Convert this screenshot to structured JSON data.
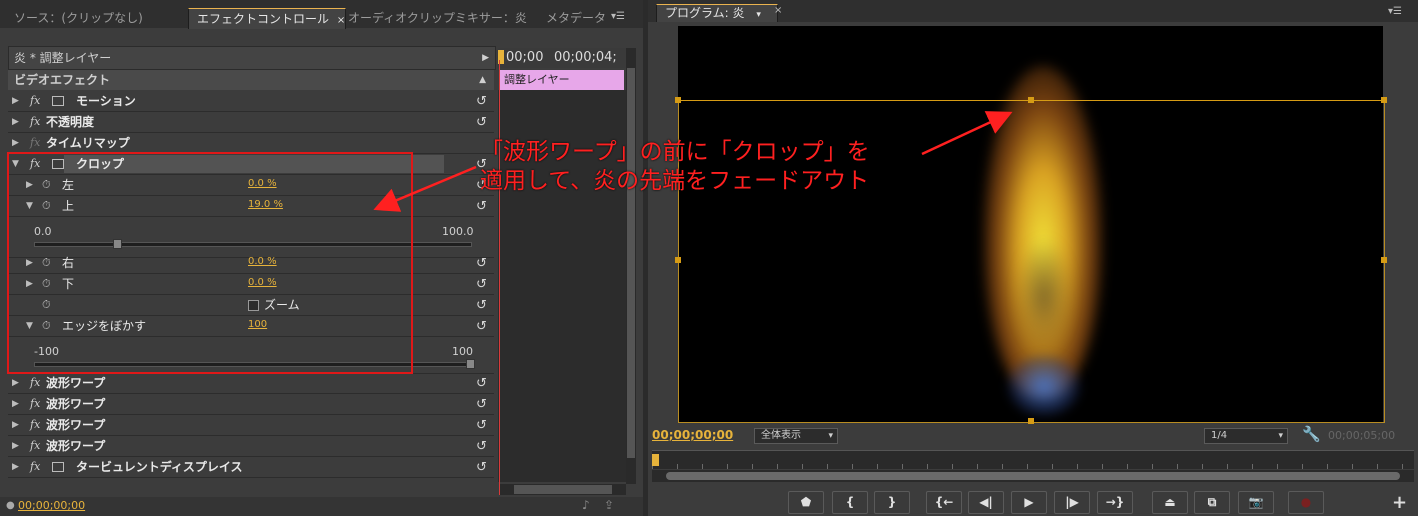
{
  "left_panel": {
    "tabs": [
      "ソース：(クリップなし)",
      "エフェクトコントロール",
      "オーディオクリップミキサー：炎",
      "メタデータ"
    ],
    "close_mark": "×",
    "clip_header": "炎 * 調整レイヤー",
    "section_title": "ビデオエフェクト",
    "timeline": {
      "t1": "00;00",
      "t2": "00;00;04;",
      "clip_label": "調整レイヤー"
    },
    "effects": [
      {
        "label": "モーション",
        "has_icon": true
      },
      {
        "label": "不透明度",
        "has_icon": false
      },
      {
        "label": "タイムリマップ",
        "has_icon": false
      },
      {
        "label": "クロップ",
        "has_icon": true
      }
    ],
    "crop_params": {
      "left": {
        "label": "左",
        "value": "0.0 %"
      },
      "top": {
        "label": "上",
        "value": "19.0 %"
      },
      "top_slider": {
        "min": "0.0",
        "max": "100.0",
        "level": 0.19
      },
      "right": {
        "label": "右",
        "value": "0.0 %"
      },
      "bottom": {
        "label": "下",
        "value": "0.0 %"
      },
      "zoom_label": "ズーム",
      "feather": {
        "label": "エッジをぼかす",
        "value": "100"
      },
      "feather_slider": {
        "min": "-100",
        "max": "100",
        "level": 1.0
      }
    },
    "more_effects": [
      "波形ワープ",
      "波形ワープ",
      "波形ワープ",
      "波形ワープ",
      "タービュレントディスプレイス"
    ],
    "timecode": "00;00;00;00"
  },
  "program_monitor": {
    "tab_label": "プログラム: 炎",
    "timecode": "00;00;00;00",
    "fit_select": "全体表示",
    "resolution_select": "1/4",
    "duration": "00;00;05;00"
  },
  "annotation": {
    "line1": "「波形ワープ」の前に「クロップ」を",
    "line2": "適用して、炎の先端をフェードアウト",
    "color": "#ff2020"
  },
  "colors": {
    "accent": "#e7b33b",
    "clip": "#e7a7e9",
    "panel": "#3c3c3c"
  }
}
